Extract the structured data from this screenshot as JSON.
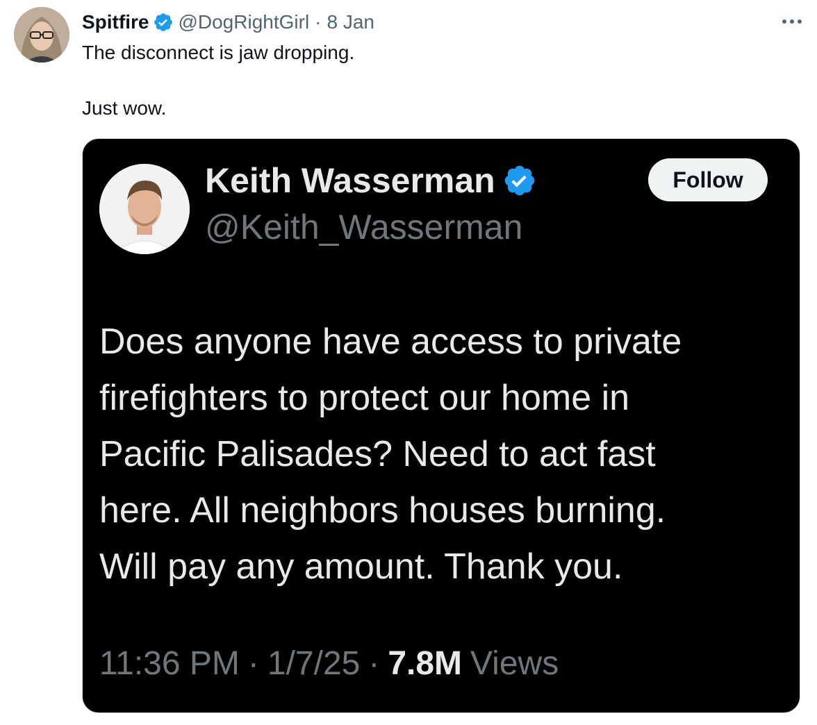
{
  "tweet": {
    "author_name": "Spitfire",
    "author_handle": "@DogRightGirl",
    "separator": "·",
    "date": "8 Jan",
    "text_line_1": "The disconnect is jaw dropping.",
    "text_line_2": "Just wow."
  },
  "quoted": {
    "author_name": "Keith Wasserman",
    "author_handle": "@Keith_Wasserman",
    "follow_label": "Follow",
    "text_lines": [
      "Does anyone have access to private",
      "firefighters to protect our home in",
      "Pacific Palisades? Need to act fast",
      "here. All neighbors houses burning.",
      "Will pay any amount. Thank you."
    ],
    "time": "11:36 PM",
    "date": "1/7/25",
    "views_count": "7.8M",
    "views_label": "Views",
    "separator": "·"
  },
  "colors": {
    "verified_blue": "#1d9bf0",
    "secondary_text": "#536471",
    "card_bg": "#000000",
    "card_text": "#e7e9ea",
    "card_secondary": "#71767b"
  },
  "icons": {
    "verified": "verified-badge-icon",
    "more": "more-dots-icon"
  }
}
